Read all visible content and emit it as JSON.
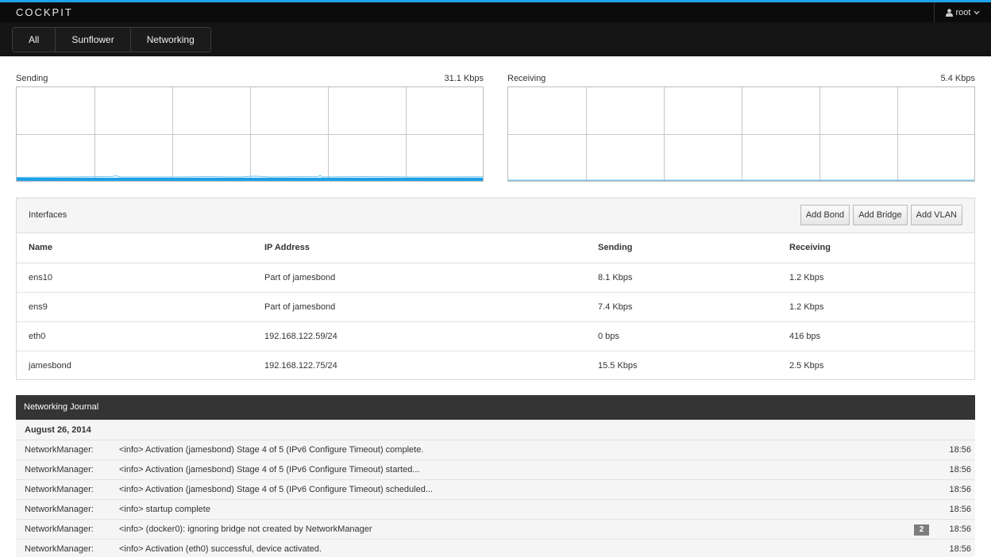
{
  "app": {
    "brand": "COCKPIT",
    "user": "root"
  },
  "icons": {
    "user": "user-icon",
    "caret": "caret-down-icon"
  },
  "colors": {
    "accent": "#1ea1e8",
    "topbar": "#0b0b0b",
    "journal_header": "#343434",
    "badge": "#7d7d7d"
  },
  "nav": {
    "tabs": [
      {
        "label": "All"
      },
      {
        "label": "Sunflower"
      },
      {
        "label": "Networking"
      }
    ]
  },
  "graphs": {
    "sending": {
      "label": "Sending",
      "rate": "31.1 Kbps"
    },
    "receiving": {
      "label": "Receiving",
      "rate": "5.4 Kbps"
    }
  },
  "interfaces": {
    "title": "Interfaces",
    "buttons": {
      "add_bond": "Add Bond",
      "add_bridge": "Add Bridge",
      "add_vlan": "Add VLAN"
    },
    "columns": {
      "name": "Name",
      "ip": "IP Address",
      "sending": "Sending",
      "receiving": "Receiving"
    },
    "rows": [
      {
        "name": "ens10",
        "ip": "Part of jamesbond",
        "sending": "8.1 Kbps",
        "receiving": "1.2 Kbps"
      },
      {
        "name": "ens9",
        "ip": "Part of jamesbond",
        "sending": "7.4 Kbps",
        "receiving": "1.2 Kbps"
      },
      {
        "name": "eth0",
        "ip": "192.168.122.59/24",
        "sending": "0 bps",
        "receiving": "416 bps"
      },
      {
        "name": "jamesbond",
        "ip": "192.168.122.75/24",
        "sending": "15.5 Kbps",
        "receiving": "2.5 Kbps"
      }
    ]
  },
  "journal": {
    "title": "Networking Journal",
    "date": "August 26, 2014",
    "entries": [
      {
        "source": "NetworkManager:",
        "message": "<info> Activation (jamesbond) Stage 4 of 5 (IPv6 Configure Timeout) complete.",
        "time": "18:56"
      },
      {
        "source": "NetworkManager:",
        "message": "<info> Activation (jamesbond) Stage 4 of 5 (IPv6 Configure Timeout) started...",
        "time": "18:56"
      },
      {
        "source": "NetworkManager:",
        "message": "<info> Activation (jamesbond) Stage 4 of 5 (IPv6 Configure Timeout) scheduled...",
        "time": "18:56"
      },
      {
        "source": "NetworkManager:",
        "message": "<info> startup complete",
        "time": "18:56"
      },
      {
        "source": "NetworkManager:",
        "message": "<info> (docker0): ignoring bridge not created by NetworkManager",
        "badge": "2",
        "time": "18:56"
      },
      {
        "source": "NetworkManager:",
        "message": "<info> Activation (eth0) successful, device activated.",
        "time": "18:56"
      }
    ]
  }
}
